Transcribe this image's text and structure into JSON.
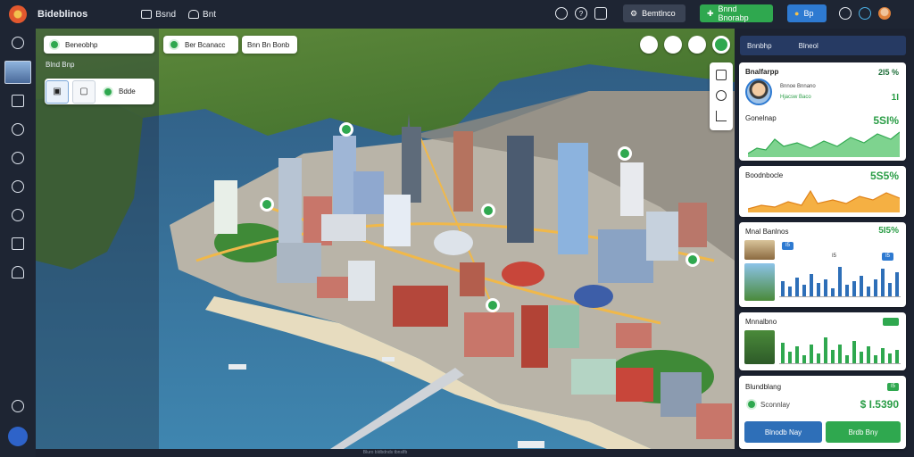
{
  "topbar": {
    "brand": "Bideblinos",
    "items": [
      {
        "label": "Bsnd",
        "icon": "window-icon"
      },
      {
        "label": "Bnt",
        "icon": "car-icon"
      }
    ],
    "right": {
      "search_icon": "search-icon",
      "help_icon": "help-icon",
      "chat_icon": "chat-icon",
      "btn_dark": "Bemtlnco",
      "btn_green": "Bnnd Bnorabp",
      "btn_blue": "Bp"
    }
  },
  "left_overlay": {
    "search_label": "Beneobhp",
    "section_label": "Blnd Bnp",
    "tools_value": "Bdde"
  },
  "map_bar": {
    "chip1": "Ber Bcanacc",
    "chip2": "Bnn Bn Bonb"
  },
  "right_panel": {
    "header": {
      "tab1": "Bnnbhp",
      "tab2": "Blneol"
    },
    "card1": {
      "title": "Bnalfarpp",
      "pct": "2I5 %",
      "name": "Bnnoe Bnnano",
      "sub": "Hjacsw Baco",
      "sub_value": "1I",
      "chart_title": "Gonelnap",
      "chart_value": "5SI%"
    },
    "card2": {
      "title": "Boodnbocle",
      "value": "5S5%"
    },
    "card3": {
      "title": "Mnal Banlnos",
      "value": "5I5%",
      "legend": [
        "I5",
        "I5",
        "I5"
      ]
    },
    "card4": {
      "title": "Mnnalbno"
    },
    "card5": {
      "title": "Blundblang",
      "sub": "Sconnlay",
      "value": "$ I.5390",
      "tag": "I5"
    },
    "buttons": {
      "primary": "Blnodb Nay",
      "secondary": "Brdb Bny"
    },
    "colors": {
      "green": "#2fa84f",
      "blue": "#2e7ad1",
      "orange": "#f39c1a"
    }
  },
  "footer": {
    "caption": "Bluro bldbdnds tbnslfb"
  }
}
